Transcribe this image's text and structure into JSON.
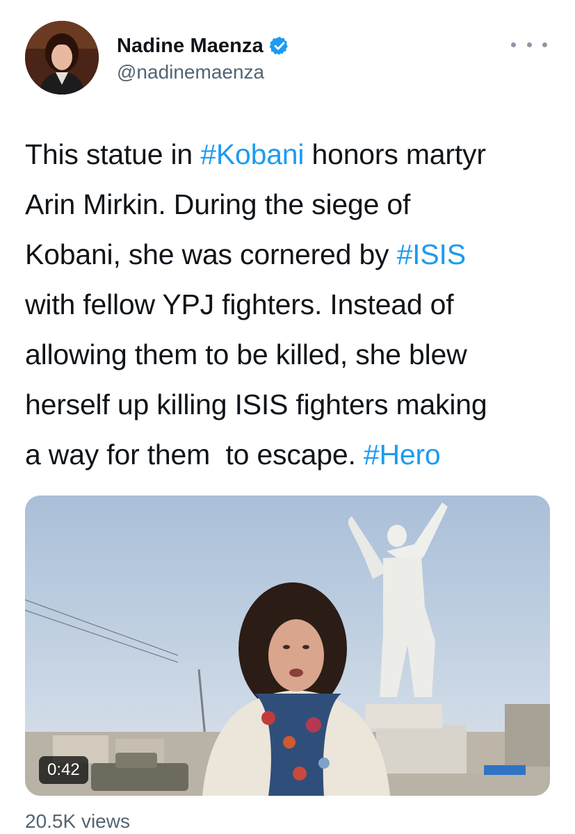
{
  "author": {
    "name": "Nadine Maenza",
    "handle": "@nadinemaenza"
  },
  "tweet": {
    "segments": [
      {
        "text": "This statue in ",
        "hashtag": false
      },
      {
        "text": "#Kobani",
        "hashtag": true
      },
      {
        "text": " honors martyr\nArin Mirkin. During the siege of\nKobani, she was cornered by ",
        "hashtag": false
      },
      {
        "text": "#ISIS",
        "hashtag": true
      },
      {
        "text": "\nwith fellow YPJ fighters. Instead of\nallowing them to be killed, she blew\nherself up killing ISIS fighters making\na way for them  to escape. ",
        "hashtag": false
      },
      {
        "text": "#Hero",
        "hashtag": true
      }
    ]
  },
  "video": {
    "duration": "0:42"
  },
  "stats": {
    "views": "20.5K views"
  },
  "icons": {
    "verified": "verified-badge-icon",
    "more": "more-options-icon"
  },
  "colors": {
    "link": "#1d9bf0",
    "secondary": "#536471",
    "text": "#0f1419"
  }
}
